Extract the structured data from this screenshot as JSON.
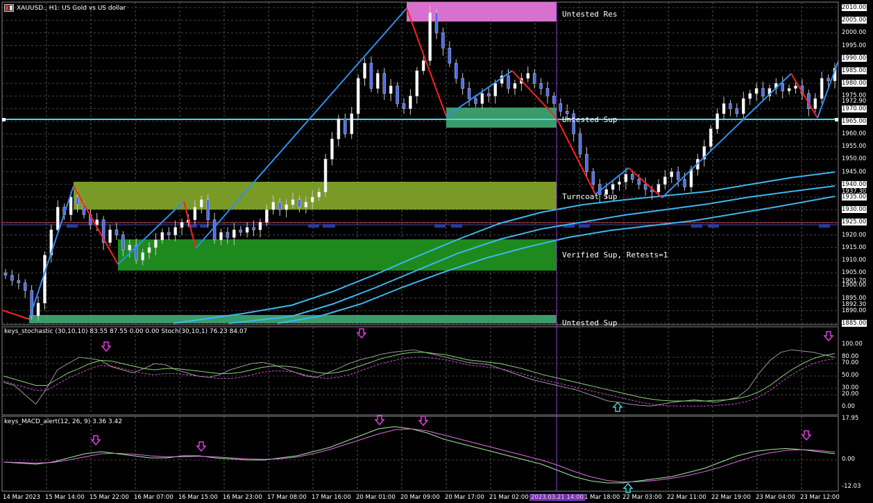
{
  "window": {
    "title": "XAUUSD., H1:  US Gold vs US dollar"
  },
  "colors": {
    "bull": "#ffffff",
    "bear": "#4a6cf0",
    "zigzag_up": "#2f8ff0",
    "zigzag_down": "#ff2020",
    "ma": "#3db8f0",
    "stoch_main": "#9a9a9a",
    "stoch_signal_green": "#8fd47a",
    "stoch_signal_pink": "#d050d0",
    "macd_main": "#a0f0a0",
    "macd_signal": "#e070e0",
    "arrow_down": "#e040e0",
    "arrow_up": "#40d0d0",
    "zone_res": "#d870d0",
    "zone_olive": "#7a9a28",
    "zone_green": "#1e8a1e",
    "zone_teal": "#3a9a6a",
    "hline": "#40e0f0"
  },
  "zones": {
    "untested_res": "Untested Res",
    "untested_sup_top": "Untested Sup",
    "turncoat_sup": "Turncoat Sup",
    "verified_sup": "Verified Sup, Retests=1",
    "untested_sup_bottom": "Untested Sup"
  },
  "price_axis": {
    "ticks": [
      "2010.00",
      "2005.00",
      "2000.00",
      "1995.00",
      "1990.00",
      "1985.00",
      "1980.00",
      "1975.00",
      "1970.00",
      "1965.00",
      "1960.00",
      "1955.00",
      "1950.00",
      "1945.00",
      "1940.00",
      "1935.00",
      "1930.00",
      "1925.00",
      "1920.00",
      "1915.00",
      "1910.00",
      "1905.00",
      "1900.00",
      "1895.00",
      "1890.00",
      "1885.00"
    ],
    "highlighted": [
      "2010.00",
      "2005.00",
      "1990.00",
      "1985.00",
      "1980.00",
      "1970.00",
      "1965.00",
      "1940.00",
      "1935.00",
      "1930.00",
      "1925.00",
      "1885.00"
    ],
    "extra": [
      {
        "label": "1972.90",
        "price": 1972.9
      },
      {
        "label": "1937.30",
        "price": 1937.3
      },
      {
        "label": "1901.70",
        "price": 1901.7
      },
      {
        "label": "1892.30",
        "price": 1892.3
      }
    ]
  },
  "time_axis": {
    "ticks": [
      "14 Mar 2023",
      "15 Mar 14:00",
      "15 Mar 22:00",
      "16 Mar 07:00",
      "16 Mar 15:00",
      "16 Mar 23:00",
      "17 Mar 08:00",
      "17 Mar 16:00",
      "20 Mar 01:00",
      "20 Mar 09:00",
      "20 Mar 17:00",
      "21 Mar 02:00",
      "2023.03.21 14:00",
      "1 Mar 18:00",
      "22 Mar 03:00",
      "22 Mar 11:00",
      "22 Mar 19:00",
      "23 Mar 04:00",
      "23 Mar 12:00"
    ],
    "highlight_index": 12
  },
  "stoch": {
    "label": "keys_stochastic (30,10,10) 83.55 87.55 0.00 0.00 Stoch(30,10,1) 76.23 84.07",
    "ticks": [
      "100.00",
      "80.00",
      "70.00",
      "50.00",
      "30.00",
      "20.00",
      "0.00"
    ]
  },
  "macd": {
    "label": "keys_MACD_alert(12, 26, 9) 3.36 3.42",
    "ticks": [
      "17.95",
      "0.00",
      "-12.03"
    ]
  },
  "chart_data": [
    {
      "type": "candlestick",
      "title": "XAUUSD., H1:  US Gold vs US dollar",
      "ylim": [
        1882,
        2012
      ],
      "closes": [
        1904,
        1902,
        1901,
        1898,
        1888,
        1893,
        1912,
        1922,
        1931,
        1928,
        1935,
        1932,
        1928,
        1924,
        1926,
        1917,
        1922,
        1920,
        1914,
        1916,
        1910,
        1913,
        1915,
        1918,
        1921,
        1920,
        1923,
        1925,
        1926,
        1931,
        1934,
        1926,
        1918,
        1921,
        1919,
        1922,
        1921,
        1923,
        1922,
        1925,
        1930,
        1933,
        1930,
        1932,
        1934,
        1931,
        1933,
        1935,
        1937,
        1950,
        1958,
        1966,
        1960,
        1968,
        1982,
        1988,
        1978,
        1984,
        1976,
        1979,
        1972,
        1970,
        1975,
        1985,
        1989,
        2008,
        2000,
        1994,
        1988,
        1982,
        1978,
        1974,
        1972,
        1976,
        1975,
        1980,
        1983,
        1978,
        1980,
        1982,
        1984,
        1980,
        1978,
        1975,
        1972,
        1969,
        1968,
        1960,
        1952,
        1945,
        1940,
        1936,
        1938,
        1940,
        1941,
        1944,
        1942,
        1940,
        1938,
        1937,
        1940,
        1943,
        1945,
        1942,
        1939,
        1946,
        1950,
        1955,
        1962,
        1968,
        1972,
        1970,
        1968,
        1974,
        1976,
        1978,
        1975,
        1978,
        1980,
        1977,
        1978,
        1979,
        1976,
        1970,
        1974,
        1982,
        1981,
        1986
      ]
    },
    {
      "type": "line",
      "title": "keys_stochastic (30,10,10) 83.55 87.55 0.00 0.00 Stoch(30,10,1) 76.23 84.07",
      "ylim": [
        0,
        100
      ],
      "series": [
        {
          "values": [
            40,
            35,
            20,
            5,
            30,
            60,
            70,
            80,
            78,
            75,
            65,
            60,
            55,
            62,
            70,
            68,
            60,
            55,
            50,
            48,
            52,
            60,
            65,
            70,
            72,
            68,
            62,
            56,
            50,
            48,
            55,
            62,
            70,
            76,
            80,
            85,
            88,
            90,
            92,
            88,
            84,
            80,
            76,
            72,
            70,
            68,
            62,
            56,
            50,
            44,
            40,
            36,
            32,
            28,
            22,
            16,
            10,
            8,
            5,
            3,
            2,
            5,
            8,
            10,
            12,
            10,
            8,
            12,
            16,
            30,
            55,
            75,
            88,
            92,
            90,
            88,
            84,
            80
          ]
        },
        {
          "values": [
            50,
            45,
            40,
            35,
            35,
            45,
            55,
            62,
            70,
            75,
            74,
            70,
            66,
            62,
            60,
            62,
            62,
            60,
            58,
            56,
            54,
            54,
            56,
            60,
            64,
            66,
            66,
            64,
            60,
            56,
            54,
            56,
            60,
            66,
            72,
            78,
            82,
            86,
            88,
            88,
            86,
            84,
            80,
            76,
            74,
            72,
            70,
            66,
            62,
            57,
            52,
            48,
            44,
            40,
            36,
            32,
            28,
            24,
            20,
            16,
            13,
            11,
            10,
            10,
            10,
            10,
            11,
            12,
            14,
            18,
            25,
            35,
            48,
            60,
            70,
            78,
            83,
            86
          ]
        }
      ]
    },
    {
      "type": "line",
      "title": "keys_MACD_alert(12, 26, 9) 3.36 3.42",
      "ylim": [
        -12.03,
        17.95
      ],
      "series": [
        {
          "values": [
            -1,
            -1.5,
            -2,
            -1,
            1,
            3,
            4,
            3,
            2,
            1,
            1,
            2,
            2,
            1,
            0.5,
            0,
            0,
            1,
            2,
            4,
            6,
            9,
            12,
            15,
            16,
            15,
            13,
            10,
            8,
            6,
            4,
            2,
            0,
            -2,
            -5,
            -8,
            -10,
            -11,
            -11,
            -10,
            -9,
            -8,
            -6,
            -4,
            -1,
            2,
            4,
            5,
            5.5,
            5,
            4,
            3
          ]
        },
        {
          "values": [
            -1,
            -1.2,
            -1.5,
            -1.2,
            0,
            1.5,
            3,
            3.2,
            2.8,
            2,
            1.5,
            1.6,
            1.8,
            1.5,
            1,
            0.5,
            0.3,
            0.6,
            1.4,
            3,
            5,
            7.5,
            10,
            12.5,
            14.5,
            15,
            14,
            12,
            10,
            8,
            6,
            4,
            2,
            0,
            -2.5,
            -5.5,
            -8,
            -9.8,
            -10.6,
            -10.4,
            -9.8,
            -8.8,
            -7.4,
            -5.6,
            -3.4,
            -0.8,
            1.6,
            3.4,
            4.6,
            5,
            4.6,
            3.8
          ]
        }
      ]
    }
  ]
}
